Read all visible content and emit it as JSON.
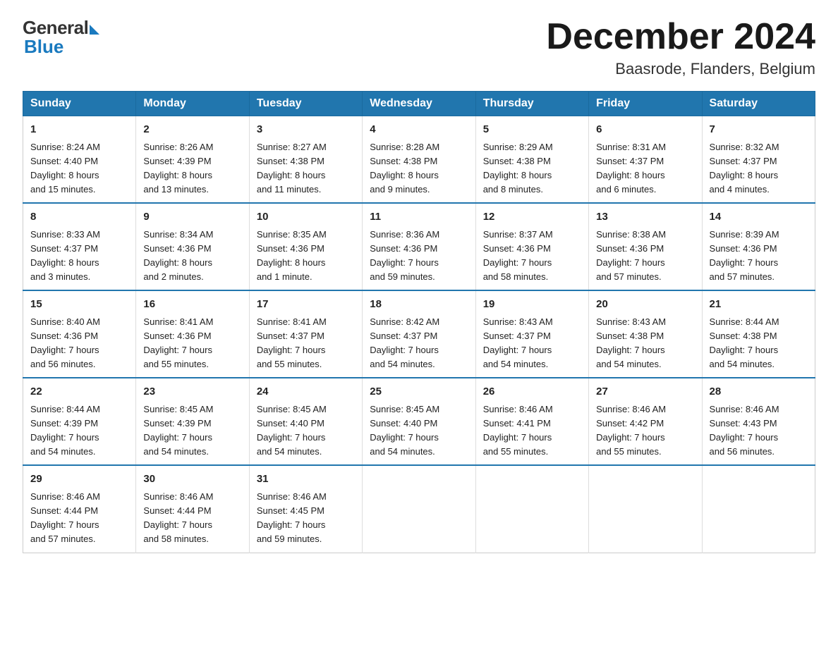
{
  "header": {
    "logo_general": "General",
    "logo_blue": "Blue",
    "month_year": "December 2024",
    "location": "Baasrode, Flanders, Belgium"
  },
  "days_of_week": [
    "Sunday",
    "Monday",
    "Tuesday",
    "Wednesday",
    "Thursday",
    "Friday",
    "Saturday"
  ],
  "weeks": [
    [
      {
        "day": "1",
        "info": "Sunrise: 8:24 AM\nSunset: 4:40 PM\nDaylight: 8 hours\nand 15 minutes."
      },
      {
        "day": "2",
        "info": "Sunrise: 8:26 AM\nSunset: 4:39 PM\nDaylight: 8 hours\nand 13 minutes."
      },
      {
        "day": "3",
        "info": "Sunrise: 8:27 AM\nSunset: 4:38 PM\nDaylight: 8 hours\nand 11 minutes."
      },
      {
        "day": "4",
        "info": "Sunrise: 8:28 AM\nSunset: 4:38 PM\nDaylight: 8 hours\nand 9 minutes."
      },
      {
        "day": "5",
        "info": "Sunrise: 8:29 AM\nSunset: 4:38 PM\nDaylight: 8 hours\nand 8 minutes."
      },
      {
        "day": "6",
        "info": "Sunrise: 8:31 AM\nSunset: 4:37 PM\nDaylight: 8 hours\nand 6 minutes."
      },
      {
        "day": "7",
        "info": "Sunrise: 8:32 AM\nSunset: 4:37 PM\nDaylight: 8 hours\nand 4 minutes."
      }
    ],
    [
      {
        "day": "8",
        "info": "Sunrise: 8:33 AM\nSunset: 4:37 PM\nDaylight: 8 hours\nand 3 minutes."
      },
      {
        "day": "9",
        "info": "Sunrise: 8:34 AM\nSunset: 4:36 PM\nDaylight: 8 hours\nand 2 minutes."
      },
      {
        "day": "10",
        "info": "Sunrise: 8:35 AM\nSunset: 4:36 PM\nDaylight: 8 hours\nand 1 minute."
      },
      {
        "day": "11",
        "info": "Sunrise: 8:36 AM\nSunset: 4:36 PM\nDaylight: 7 hours\nand 59 minutes."
      },
      {
        "day": "12",
        "info": "Sunrise: 8:37 AM\nSunset: 4:36 PM\nDaylight: 7 hours\nand 58 minutes."
      },
      {
        "day": "13",
        "info": "Sunrise: 8:38 AM\nSunset: 4:36 PM\nDaylight: 7 hours\nand 57 minutes."
      },
      {
        "day": "14",
        "info": "Sunrise: 8:39 AM\nSunset: 4:36 PM\nDaylight: 7 hours\nand 57 minutes."
      }
    ],
    [
      {
        "day": "15",
        "info": "Sunrise: 8:40 AM\nSunset: 4:36 PM\nDaylight: 7 hours\nand 56 minutes."
      },
      {
        "day": "16",
        "info": "Sunrise: 8:41 AM\nSunset: 4:36 PM\nDaylight: 7 hours\nand 55 minutes."
      },
      {
        "day": "17",
        "info": "Sunrise: 8:41 AM\nSunset: 4:37 PM\nDaylight: 7 hours\nand 55 minutes."
      },
      {
        "day": "18",
        "info": "Sunrise: 8:42 AM\nSunset: 4:37 PM\nDaylight: 7 hours\nand 54 minutes."
      },
      {
        "day": "19",
        "info": "Sunrise: 8:43 AM\nSunset: 4:37 PM\nDaylight: 7 hours\nand 54 minutes."
      },
      {
        "day": "20",
        "info": "Sunrise: 8:43 AM\nSunset: 4:38 PM\nDaylight: 7 hours\nand 54 minutes."
      },
      {
        "day": "21",
        "info": "Sunrise: 8:44 AM\nSunset: 4:38 PM\nDaylight: 7 hours\nand 54 minutes."
      }
    ],
    [
      {
        "day": "22",
        "info": "Sunrise: 8:44 AM\nSunset: 4:39 PM\nDaylight: 7 hours\nand 54 minutes."
      },
      {
        "day": "23",
        "info": "Sunrise: 8:45 AM\nSunset: 4:39 PM\nDaylight: 7 hours\nand 54 minutes."
      },
      {
        "day": "24",
        "info": "Sunrise: 8:45 AM\nSunset: 4:40 PM\nDaylight: 7 hours\nand 54 minutes."
      },
      {
        "day": "25",
        "info": "Sunrise: 8:45 AM\nSunset: 4:40 PM\nDaylight: 7 hours\nand 54 minutes."
      },
      {
        "day": "26",
        "info": "Sunrise: 8:46 AM\nSunset: 4:41 PM\nDaylight: 7 hours\nand 55 minutes."
      },
      {
        "day": "27",
        "info": "Sunrise: 8:46 AM\nSunset: 4:42 PM\nDaylight: 7 hours\nand 55 minutes."
      },
      {
        "day": "28",
        "info": "Sunrise: 8:46 AM\nSunset: 4:43 PM\nDaylight: 7 hours\nand 56 minutes."
      }
    ],
    [
      {
        "day": "29",
        "info": "Sunrise: 8:46 AM\nSunset: 4:44 PM\nDaylight: 7 hours\nand 57 minutes."
      },
      {
        "day": "30",
        "info": "Sunrise: 8:46 AM\nSunset: 4:44 PM\nDaylight: 7 hours\nand 58 minutes."
      },
      {
        "day": "31",
        "info": "Sunrise: 8:46 AM\nSunset: 4:45 PM\nDaylight: 7 hours\nand 59 minutes."
      },
      {
        "day": "",
        "info": ""
      },
      {
        "day": "",
        "info": ""
      },
      {
        "day": "",
        "info": ""
      },
      {
        "day": "",
        "info": ""
      }
    ]
  ]
}
